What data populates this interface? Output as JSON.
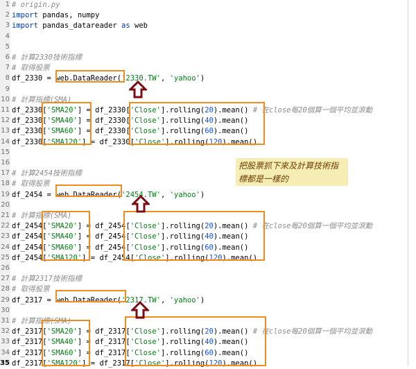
{
  "editor": {
    "lines": [
      {
        "n": "1",
        "tokens": [
          [
            "c",
            "# origin.py"
          ]
        ]
      },
      {
        "n": "2",
        "tokens": [
          [
            "k",
            "import"
          ],
          [
            "t",
            " pandas, numpy"
          ]
        ]
      },
      {
        "n": "3",
        "tokens": [
          [
            "k",
            "import"
          ],
          [
            "t",
            " pandas_datareader "
          ],
          [
            "k",
            "as"
          ],
          [
            "t",
            " web"
          ]
        ]
      },
      {
        "n": "4",
        "tokens": []
      },
      {
        "n": "5",
        "tokens": []
      },
      {
        "n": "6",
        "tokens": [
          [
            "c",
            "# 計算2330技術指標"
          ]
        ]
      },
      {
        "n": "7",
        "tokens": [
          [
            "c",
            "# 取得股票"
          ]
        ]
      },
      {
        "n": "8",
        "tokens": [
          [
            "t",
            "df_2330 = web.DataReader("
          ],
          [
            "s",
            "'2330.TW'"
          ],
          [
            "t",
            ", "
          ],
          [
            "s",
            "'yahoo'"
          ],
          [
            "t",
            ")"
          ]
        ]
      },
      {
        "n": "9",
        "tokens": []
      },
      {
        "n": "10",
        "tokens": [
          [
            "c",
            "# 計算指標(SMA)"
          ]
        ]
      },
      {
        "n": "11",
        "tokens": [
          [
            "t",
            "df_2330["
          ],
          [
            "s",
            "'SMA20'"
          ],
          [
            "t",
            "] = df_2330["
          ],
          [
            "s",
            "'Close'"
          ],
          [
            "t",
            "].rolling("
          ],
          [
            "n",
            "20"
          ],
          [
            "t",
            ").mean() "
          ],
          [
            "c",
            "# 在close每20個算一個平均並滾動"
          ]
        ]
      },
      {
        "n": "12",
        "tokens": [
          [
            "t",
            "df_2330["
          ],
          [
            "s",
            "'SMA40'"
          ],
          [
            "t",
            "] = df_2330["
          ],
          [
            "s",
            "'Close'"
          ],
          [
            "t",
            "].rolling("
          ],
          [
            "n",
            "40"
          ],
          [
            "t",
            ").mean()"
          ]
        ]
      },
      {
        "n": "13",
        "tokens": [
          [
            "t",
            "df_2330["
          ],
          [
            "s",
            "'SMA60'"
          ],
          [
            "t",
            "] = df_2330["
          ],
          [
            "s",
            "'Close'"
          ],
          [
            "t",
            "].rolling("
          ],
          [
            "n",
            "60"
          ],
          [
            "t",
            ").mean()"
          ]
        ]
      },
      {
        "n": "14",
        "tokens": [
          [
            "t",
            "df_2330["
          ],
          [
            "s",
            "'SMA120'"
          ],
          [
            "t",
            "] = df_2330["
          ],
          [
            "s",
            "'Close'"
          ],
          [
            "t",
            "].rolling("
          ],
          [
            "n",
            "120"
          ],
          [
            "t",
            ").mean()"
          ]
        ]
      },
      {
        "n": "15",
        "tokens": []
      },
      {
        "n": "16",
        "tokens": []
      },
      {
        "n": "17",
        "tokens": [
          [
            "c",
            "# 計算2454技術指標"
          ]
        ]
      },
      {
        "n": "18",
        "tokens": [
          [
            "c",
            "# 取得股票"
          ]
        ]
      },
      {
        "n": "19",
        "tokens": [
          [
            "t",
            "df_2454 = web.DataReader("
          ],
          [
            "s",
            "'2454.TW'"
          ],
          [
            "t",
            ", "
          ],
          [
            "s",
            "'yahoo'"
          ],
          [
            "t",
            ")"
          ]
        ]
      },
      {
        "n": "20",
        "tokens": []
      },
      {
        "n": "21",
        "tokens": [
          [
            "c",
            "# 計算指標(SMA)"
          ]
        ]
      },
      {
        "n": "22",
        "tokens": [
          [
            "t",
            "df_2454["
          ],
          [
            "s",
            "'SMA20'"
          ],
          [
            "t",
            "] = df_2454["
          ],
          [
            "s",
            "'Close'"
          ],
          [
            "t",
            "].rolling("
          ],
          [
            "n",
            "20"
          ],
          [
            "t",
            ").mean() "
          ],
          [
            "c",
            "# 在close每20個算一個平均並滾動"
          ]
        ]
      },
      {
        "n": "23",
        "tokens": [
          [
            "t",
            "df_2454["
          ],
          [
            "s",
            "'SMA40'"
          ],
          [
            "t",
            "] = df_2454["
          ],
          [
            "s",
            "'Close'"
          ],
          [
            "t",
            "].rolling("
          ],
          [
            "n",
            "40"
          ],
          [
            "t",
            ").mean()"
          ]
        ]
      },
      {
        "n": "24",
        "tokens": [
          [
            "t",
            "df_2454["
          ],
          [
            "s",
            "'SMA60'"
          ],
          [
            "t",
            "] = df_2454["
          ],
          [
            "s",
            "'Close'"
          ],
          [
            "t",
            "].rolling("
          ],
          [
            "n",
            "60"
          ],
          [
            "t",
            ").mean()"
          ]
        ]
      },
      {
        "n": "25",
        "tokens": [
          [
            "t",
            "df_2454["
          ],
          [
            "s",
            "'SMA120'"
          ],
          [
            "t",
            "] = df_2454["
          ],
          [
            "s",
            "'Close'"
          ],
          [
            "t",
            "].rolling("
          ],
          [
            "n",
            "120"
          ],
          [
            "t",
            ").mean()"
          ]
        ]
      },
      {
        "n": "26",
        "tokens": []
      },
      {
        "n": "27",
        "tokens": [
          [
            "c",
            "# 計算2317技術指標"
          ]
        ]
      },
      {
        "n": "28",
        "tokens": [
          [
            "c",
            "# 取得股票"
          ]
        ]
      },
      {
        "n": "29",
        "tokens": [
          [
            "t",
            "df_2317 = web.DataReader("
          ],
          [
            "s",
            "'2317.TW'"
          ],
          [
            "t",
            ", "
          ],
          [
            "s",
            "'yahoo'"
          ],
          [
            "t",
            ")"
          ]
        ]
      },
      {
        "n": "30",
        "tokens": []
      },
      {
        "n": "31",
        "tokens": [
          [
            "c",
            "# 計算指標(SMA)"
          ]
        ]
      },
      {
        "n": "32",
        "tokens": [
          [
            "t",
            "df_2317["
          ],
          [
            "s",
            "'SMA20'"
          ],
          [
            "t",
            "] = df_2317["
          ],
          [
            "s",
            "'Close'"
          ],
          [
            "t",
            "].rolling("
          ],
          [
            "n",
            "20"
          ],
          [
            "t",
            ").mean() "
          ],
          [
            "c",
            "# 在close每20個算一個平均並滾動"
          ]
        ]
      },
      {
        "n": "33",
        "tokens": [
          [
            "t",
            "df_2317["
          ],
          [
            "s",
            "'SMA40'"
          ],
          [
            "t",
            "] = df_2317["
          ],
          [
            "s",
            "'Close'"
          ],
          [
            "t",
            "].rolling("
          ],
          [
            "n",
            "40"
          ],
          [
            "t",
            ").mean()"
          ]
        ]
      },
      {
        "n": "34",
        "tokens": [
          [
            "t",
            "df_2317["
          ],
          [
            "s",
            "'SMA60'"
          ],
          [
            "t",
            "] = df_2317["
          ],
          [
            "s",
            "'Close'"
          ],
          [
            "t",
            "].rolling("
          ],
          [
            "n",
            "60"
          ],
          [
            "t",
            ").mean()"
          ]
        ]
      },
      {
        "n": "35",
        "tokens": [
          [
            "t",
            "df_2317["
          ],
          [
            "s",
            "'SMA120'"
          ],
          [
            "t",
            "] = df_2317["
          ],
          [
            "s",
            "'Close'"
          ],
          [
            "t",
            "].rolling("
          ],
          [
            "n",
            "120"
          ],
          [
            "t",
            ").mean()"
          ]
        ]
      }
    ],
    "current_line": "35"
  },
  "annotation": {
    "note_text": "把股票抓下來及計算技術指標都是一樣的",
    "box_color": "#f08c1e",
    "arrow_color": "#7a0d14"
  }
}
